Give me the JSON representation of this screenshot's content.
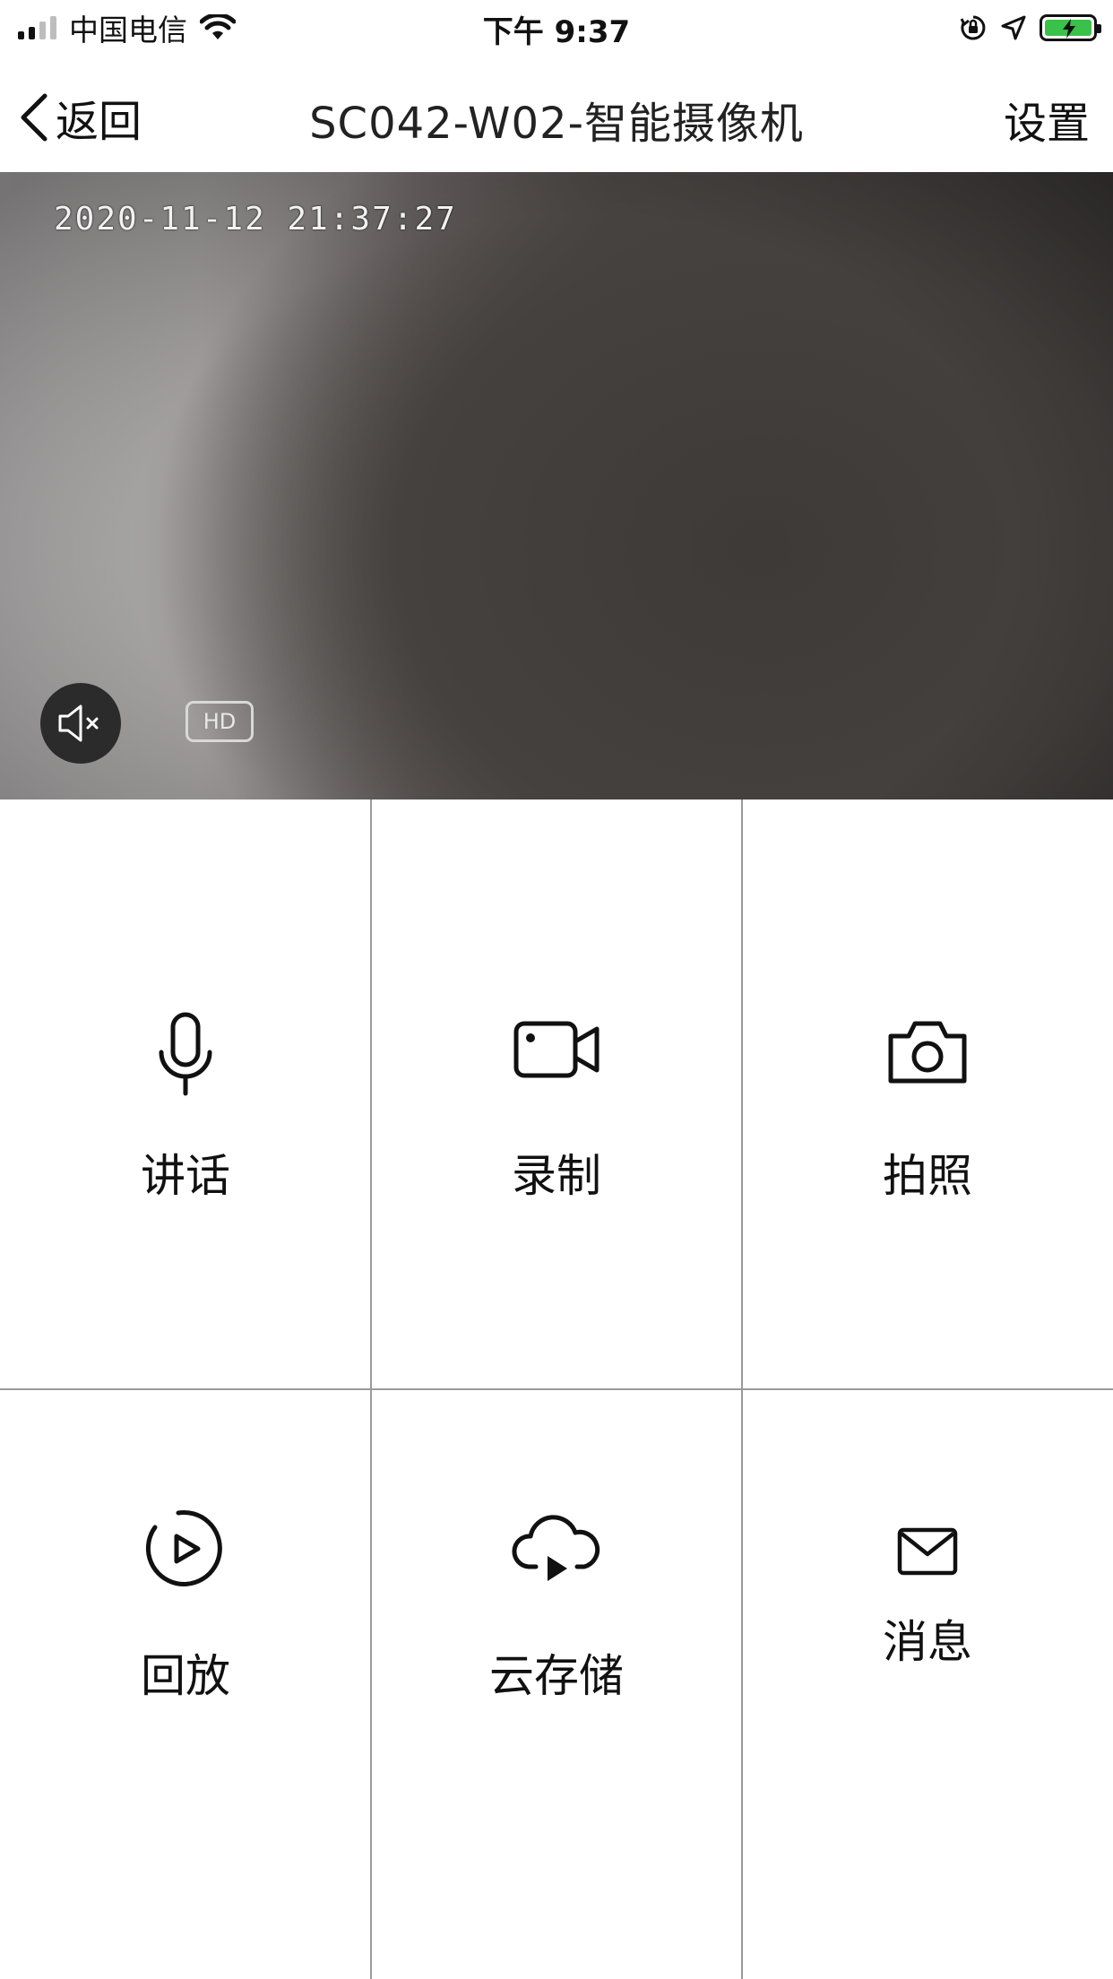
{
  "status_bar": {
    "carrier": "中国电信",
    "time": "下午 9:37"
  },
  "nav": {
    "back_label": "返回",
    "title": "SC042-W02-智能摄像机",
    "settings_label": "设置"
  },
  "video": {
    "timestamp": "2020-11-12 21:37:27",
    "quality_badge": "HD"
  },
  "actions": [
    {
      "label": "讲话",
      "icon": "microphone-icon"
    },
    {
      "label": "录制",
      "icon": "video-camera-icon"
    },
    {
      "label": "拍照",
      "icon": "camera-icon"
    },
    {
      "label": "回放",
      "icon": "playback-icon"
    },
    {
      "label": "云存储",
      "icon": "cloud-play-icon"
    },
    {
      "label": "消息",
      "icon": "envelope-icon"
    }
  ],
  "colors": {
    "battery_fill": "#3ac14a",
    "divider": "#9a9a9a",
    "text": "#111111"
  }
}
